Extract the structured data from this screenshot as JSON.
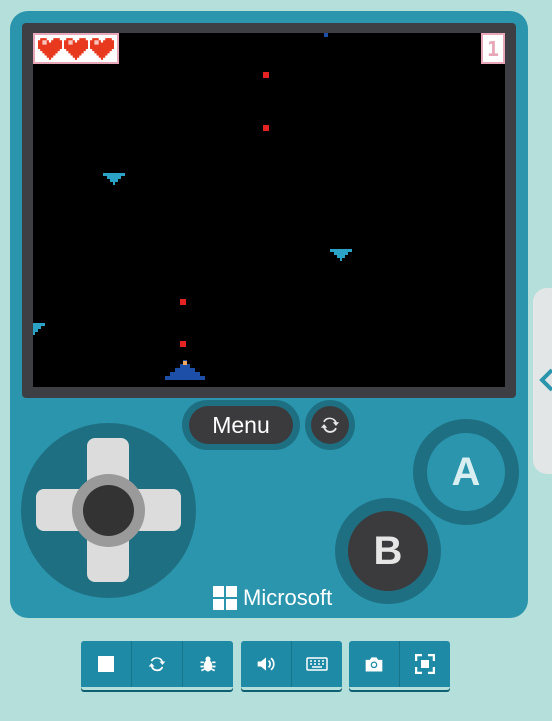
{
  "game": {
    "lives": 3,
    "score": "1"
  },
  "controls": {
    "menu_label": "Menu",
    "a_label": "A",
    "b_label": "B",
    "restart_icon": "refresh-icon"
  },
  "brand": {
    "name": "Microsoft"
  },
  "toolbar": {
    "groups": [
      [
        "stop-icon",
        "restart-icon",
        "debug-icon"
      ],
      [
        "sound-icon",
        "keyboard-icon"
      ],
      [
        "screenshot-icon",
        "fullscreen-icon"
      ]
    ]
  },
  "colors": {
    "console": "#2a95ac",
    "screen": "#000000",
    "projectile": "#e52323",
    "enemy": "#2aa3c6",
    "player": "#1d4fa8",
    "heart": "#e8391f"
  }
}
